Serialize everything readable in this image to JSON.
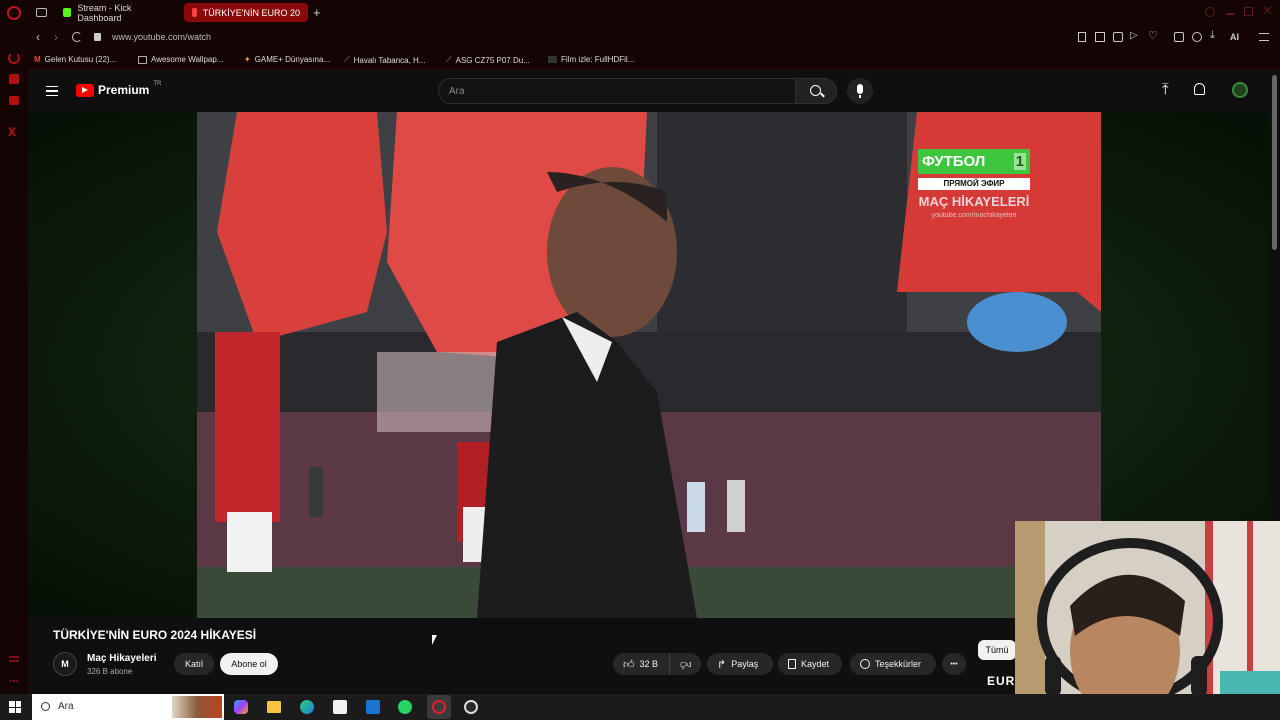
{
  "browser": {
    "tabs": [
      {
        "label": "Stream - Kick Dashboard",
        "favicon_color": "#53fc18",
        "active": false
      },
      {
        "label": "TÜRKİYE'NİN EURO 20",
        "favicon_color": "#ff0000",
        "active": true
      }
    ],
    "new_tab_label": "+",
    "url": "www.youtube.com/watch",
    "bookmarks": [
      {
        "label": "Gelen Kutusu (22)...",
        "icon": "gmail-icon"
      },
      {
        "label": "Awesome Wallpap...",
        "icon": "wallpaper-icon"
      },
      {
        "label": "GAME+ Dünyasına...",
        "icon": "game-icon"
      },
      {
        "label": "Havalı Tabanca, H...",
        "icon": "gun-icon"
      },
      {
        "label": "ASG CZ75 P07 Du...",
        "icon": "gun-icon"
      },
      {
        "label": "Film izle: FullHDFil...",
        "icon": "film-icon"
      }
    ],
    "ai_label": "AI"
  },
  "youtube": {
    "logo_text": "Premium",
    "logo_superscript": "TR",
    "search_placeholder": "Ara"
  },
  "video": {
    "overlay_channel_badge": "ФУТБОЛ",
    "overlay_badge_number": "1",
    "overlay_live_label": "ПРЯМОЙ ЭФИР",
    "overlay_watermark": "MAÇ HİKAYELERİ",
    "overlay_watermark_url": "youtube.com/machikayeleri",
    "title": "TÜRKİYE'NİN EURO 2024 HİKAYESİ"
  },
  "channel": {
    "name": "Maç Hikayeleri",
    "subscribers": "326 B abone",
    "join_label": "Katıl",
    "subscribe_label": "Abone ol"
  },
  "actions": {
    "likes": "32 B",
    "share_label": "Paylaş",
    "save_label": "Kaydet",
    "thanks_label": "Teşekkürler",
    "all_label": "Tümü",
    "more_label": "•••"
  },
  "webcam": {
    "corner_text": "EUR"
  },
  "taskbar": {
    "search_placeholder": "Ara",
    "apps": [
      "copilot-icon",
      "file-explorer-icon",
      "edge-icon",
      "store-icon",
      "outlook-icon",
      "whatsapp-icon",
      "opera-icon",
      "chrome-like-icon"
    ]
  },
  "colors": {
    "browser_bg": "#150404",
    "active_tab": "#8a0a0a",
    "youtube_red": "#ff0000",
    "page_bg": "#0f0f0f"
  }
}
